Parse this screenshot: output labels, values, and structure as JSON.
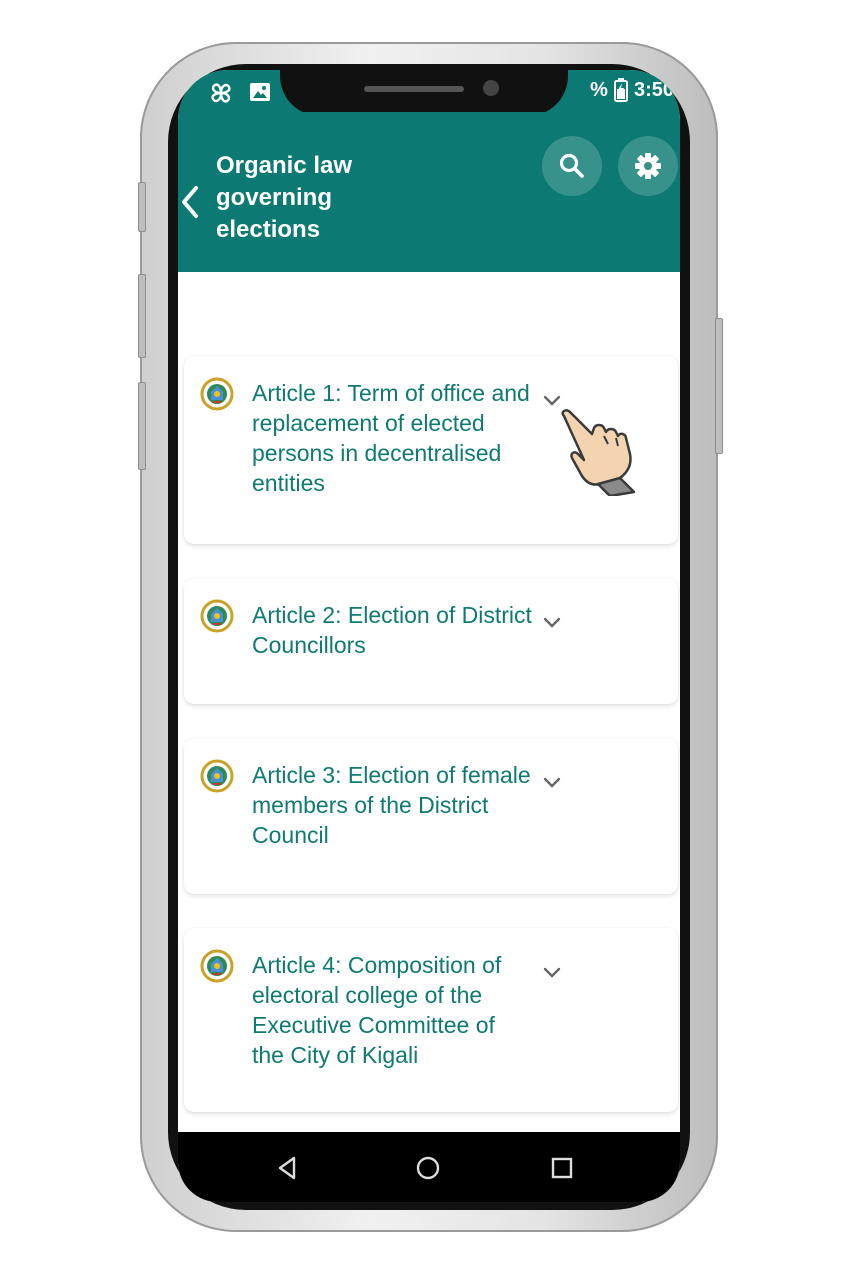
{
  "status_bar": {
    "time": "3:50",
    "battery_fragment": "%",
    "icons": [
      "pinwheel-icon",
      "image-icon",
      "battery-icon"
    ]
  },
  "app_bar": {
    "title": "Organic law governing elections",
    "back_icon": "chevron-left-icon",
    "search_icon": "search-icon",
    "settings_icon": "gear-icon"
  },
  "articles": [
    {
      "label": "Article 1: Term of office and replacement of elected persons in decentralised entities"
    },
    {
      "label": "Article 2: Election of District Councillors"
    },
    {
      "label": "Article 3: Election of female members of the District Council"
    },
    {
      "label": "Article 4: Composition of electoral college of the Executive Committee of the City of Kigali"
    }
  ],
  "navigation_bar": {
    "back": "triangle-back-icon",
    "home": "circle-home-icon",
    "recents": "square-recents-icon"
  },
  "colors": {
    "primary": "#0c7a72",
    "text_accent": "#0f7a72",
    "chevron": "#666666"
  }
}
